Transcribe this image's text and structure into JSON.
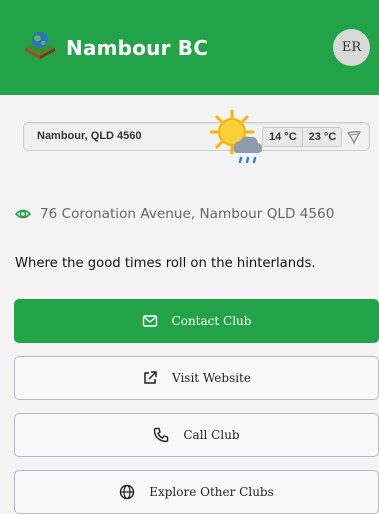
{
  "header": {
    "title": "Nambour BC",
    "logo_icon": "bowling-green-globe-icon",
    "avatar_initials": "ER",
    "background_color": "#22a347"
  },
  "weather": {
    "location": "Nambour, QLD 4560",
    "condition_icon": "sun-cloud-rain-icon",
    "temp_min": "14 °C",
    "temp_max": "23 °C",
    "wind_icon": "wind-icon"
  },
  "club": {
    "address": "76 Coronation Avenue, Nambour QLD 4560",
    "tagline": "Where the good times roll on the hinterlands."
  },
  "actions": [
    {
      "label": "Contact Club",
      "icon": "mail-icon",
      "style": "primary"
    },
    {
      "label": "Visit Website",
      "icon": "external-link-icon",
      "style": "outline"
    },
    {
      "label": "Call Club",
      "icon": "phone-icon",
      "style": "outline"
    },
    {
      "label": "Explore Other Clubs",
      "icon": "globe-icon",
      "style": "outline"
    }
  ],
  "colors": {
    "primary": "#22a347",
    "outline_border": "#b9b9c4"
  }
}
